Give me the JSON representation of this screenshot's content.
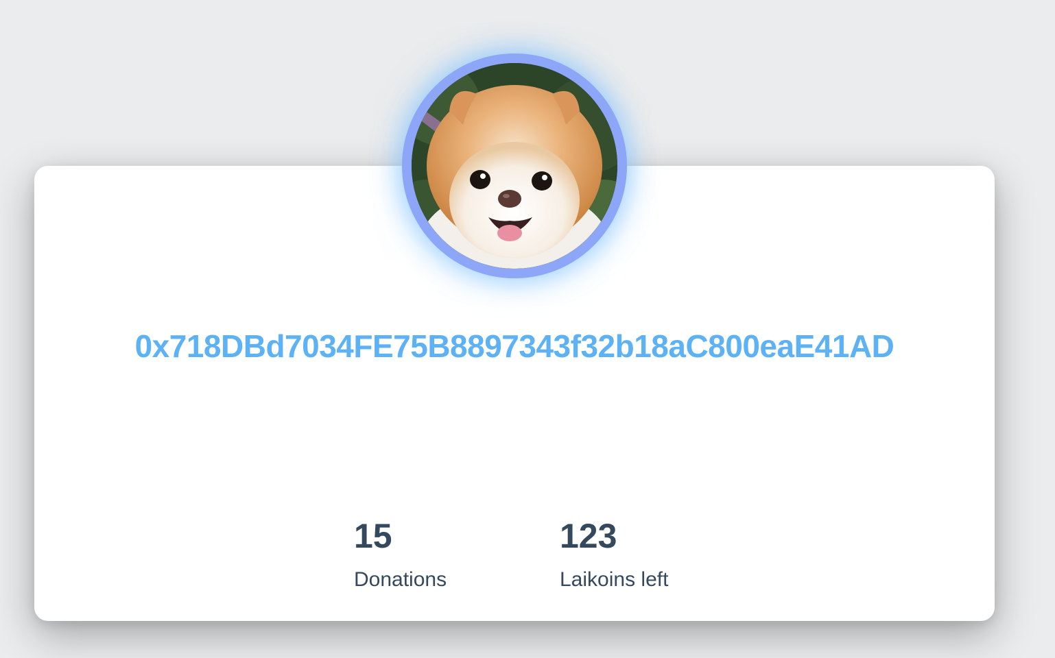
{
  "profile": {
    "wallet_address": "0x718DBd7034FE75B8897343f32b18aC800eaE41AD",
    "avatar_alt": "Pomeranian dog",
    "accent_color": "#5cb2f5",
    "ring_color": "#8da6f7"
  },
  "stats": [
    {
      "value": "15",
      "label": "Donations"
    },
    {
      "value": "123",
      "label": "Laikoins left"
    }
  ]
}
